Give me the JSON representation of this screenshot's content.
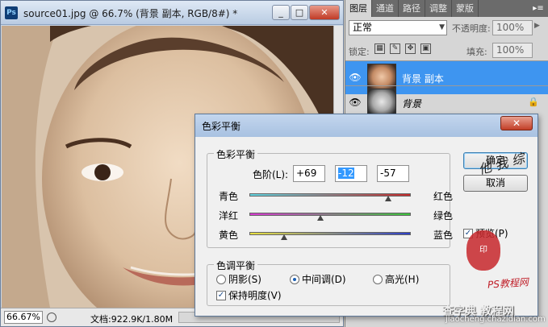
{
  "document": {
    "title": "source01.jpg @ 66.7% (背景 副本, RGB/8#) *",
    "ps_icon": "Ps",
    "zoom": "66.67%",
    "doc_info": "文档:922.9K/1.80M",
    "window_buttons": {
      "minimize": "_",
      "restore": "□",
      "close": "✕"
    }
  },
  "layers_panel": {
    "tabs": [
      "图层",
      "通道",
      "路径",
      "调整",
      "蒙版"
    ],
    "active_tab": 0,
    "menu_icon": "▸≡",
    "blend_mode": "正常",
    "opacity_label": "不透明度:",
    "opacity_value": "100%",
    "lock_label": "锁定:",
    "fill_label": "填充:",
    "fill_value": "100%",
    "layers": [
      {
        "name": "背景 副本",
        "selected": true,
        "visible": true,
        "locked": false
      },
      {
        "name": "背景",
        "selected": false,
        "visible": true,
        "locked": true
      }
    ]
  },
  "dialog": {
    "title": "色彩平衡",
    "close": "✕",
    "color_balance_group": "色彩平衡",
    "levels_label": "色阶(L):",
    "levels": [
      "+69",
      "-12",
      "-57"
    ],
    "sliders": [
      {
        "left": "青色",
        "right": "红色",
        "value": 69,
        "track": "#5fd4e0|#c62a2a"
      },
      {
        "left": "洋红",
        "right": "绿色",
        "value": -12,
        "track": "#d63ad0|#3cc43c"
      },
      {
        "left": "黄色",
        "right": "蓝色",
        "value": -57,
        "track": "#e8e040|#2d3fc8"
      }
    ],
    "tone_group": "色调平衡",
    "tone_options": [
      "阴影(S)",
      "中间调(D)",
      "高光(H)"
    ],
    "tone_selected": 1,
    "preserve_luminosity": "保持明度(V)",
    "preserve_checked": true,
    "ok_button": "确定",
    "cancel_button": "取消",
    "preview_label": "预览(P)",
    "preview_checked": true
  },
  "watermarks": {
    "ps_tutorial": "PS教程网",
    "site": "查字典 教程网",
    "url": "jiaocheng.chazidian.com"
  }
}
